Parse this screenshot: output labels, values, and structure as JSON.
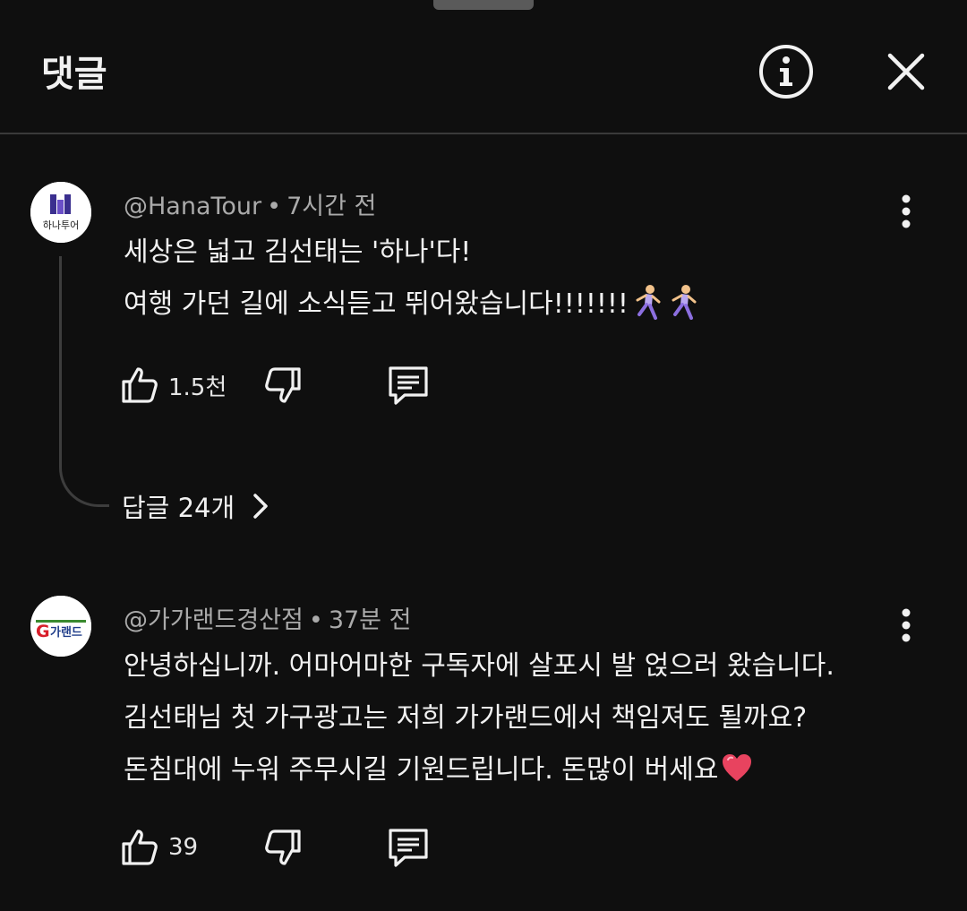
{
  "header": {
    "title": "댓글",
    "info_icon": "info-icon",
    "close_icon": "close-icon"
  },
  "colors": {
    "background": "#0f0f0f",
    "text": "#f1f1f1",
    "meta": "#aaaaaa",
    "divider": "#3a3a3a"
  },
  "comments": [
    {
      "author": "@HanaTour",
      "time": "7시간 전",
      "avatar_text": "하나투어",
      "lines": [
        "세상은 넓고 김선태는 '하나'다!",
        "여행 가던 길에 소식듣고 뛰어왔습니다!!!!!!!"
      ],
      "emoji": [
        "runner-icon",
        "runner-icon"
      ],
      "likes": "1.5천",
      "replies_label": "답글 24개"
    },
    {
      "author": "@가가랜드경산점",
      "time": "37분 전",
      "avatar_text": "G가랜드",
      "lines": [
        "안녕하십니까. 어마어마한 구독자에 살포시 발 얹으러 왔습니다.",
        "김선태님 첫 가구광고는 저희 가가랜드에서 책임져도 될까요?",
        "돈침대에 누워 주무시길 기원드립니다. 돈많이 버세요"
      ],
      "emoji": [
        "heart-icon"
      ],
      "likes": "39"
    }
  ]
}
